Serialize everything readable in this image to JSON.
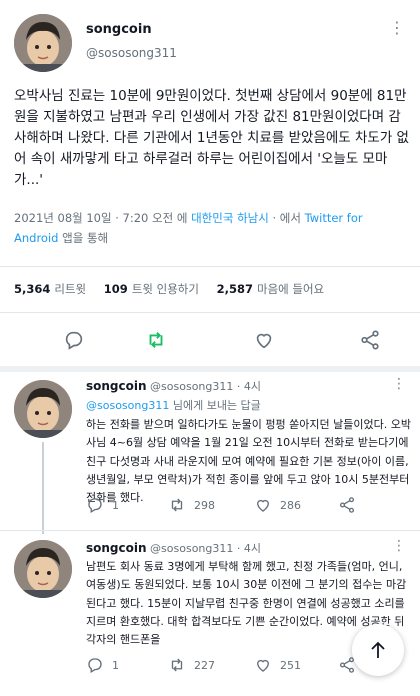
{
  "main_tweet": {
    "display_name": "songcoin",
    "handle": "@sososong311",
    "more_icon": "more-horizontal-icon",
    "body": "오박사님 진료는 10분에 9만원이었다. 첫번째 상담에서 90분에 81만원을 지불하였고 남편과 우리 인생에서 가장 값진 81만원이었다며 감사해하며 나왔다. 다른 기관에서 1년동안 치료를 받았음에도 차도가 없어 속이 새까맣게 타고 하루걸러 하루는 어린이집에서 '오늘도 모마가...'",
    "timestamp": "2021년 08월 10일 · 7:20 오전 에 ",
    "location": "대한민국 하남시",
    "via_prefix": " · 에서 ",
    "via": "Twitter for Android",
    "via_suffix": " 앱을 통해",
    "stats": {
      "retweets": "5,364",
      "retweets_label": "리트윗",
      "quotes": "109",
      "quotes_label": "트윗 인용하기",
      "likes": "2,587",
      "likes_label": "마음에 들어요"
    },
    "actions": {
      "reply_icon": "reply-icon",
      "retweet_icon": "retweet-icon",
      "like_icon": "heart-icon",
      "share_icon": "share-icon",
      "retweet_color": "#17bf63"
    }
  },
  "replies": [
    {
      "display_name": "songcoin",
      "handle": "@sososong311",
      "time": "· 4시",
      "reply_to_mention": "@sososong311",
      "reply_to_suffix": " 님에게 보내는 답글",
      "text": "하는 전화를 받으며 일하다가도 눈물이 펑펑 쏟아지던 날들이었다. 오박사님 4~6월 상담 예약을 1월 21일 오전 10시부터 전화로 받는다기에 친구 다섯명과 사내 라운지에 모여 예약에 필요한 기본 정보(아이 이름, 생년월일, 부모 연락처)가 적힌 종이를 앞에 두고 앉아 10시 5분전부터 전화를 했다.",
      "reply_count": "1",
      "retweet_count": "298",
      "like_count": "286"
    },
    {
      "display_name": "songcoin",
      "handle": "@sososong311",
      "time": "· 4시",
      "text": "남편도 회사 동료 3명에게 부탁해 함께 했고, 친정 가족들(엄마, 언니, 여동생)도 동원되었다. 보통 10시 30분 이전에 그 분기의 접수는 마감된다고 했다. 15분이 지날무렵 친구중 한명이 연결에 성공했고 소리를 지르며 환호했다. 대학 합격보다도 기쁜 순간이었다. 예약에 성공한 뒤 각자의 핸드폰을",
      "reply_count": "1",
      "retweet_count": "227",
      "like_count": "251"
    }
  ],
  "fab_icon": "arrow-up-icon",
  "colors": {
    "link": "#1d9bf0",
    "muted": "#65707a",
    "text": "#141823"
  }
}
